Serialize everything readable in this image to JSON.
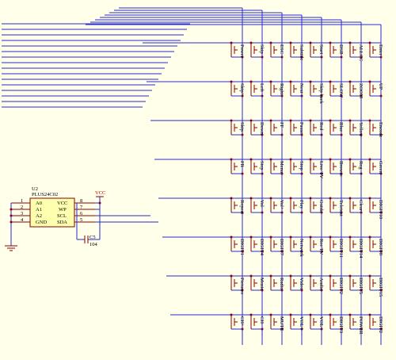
{
  "ic": {
    "ref": "U2",
    "part": "PLUS24C02",
    "left_pins": [
      {
        "name": "A0",
        "num": "1"
      },
      {
        "name": "A1",
        "num": "2"
      },
      {
        "name": "A2",
        "num": "3"
      },
      {
        "name": "GND",
        "num": "4"
      }
    ],
    "right_pins": [
      {
        "name": "VCC",
        "num": "8"
      },
      {
        "name": "WP",
        "num": "7"
      },
      {
        "name": "SCL",
        "num": "6"
      },
      {
        "name": "SDA",
        "num": "5"
      }
    ]
  },
  "vcc_label": "VCC",
  "cap": {
    "ref": "C5",
    "value": "104"
  },
  "keys": [
    [
      "Power",
      "Skip",
      "ESC",
      "Subtitle",
      "Start",
      "DSB",
      "ALLCC",
      "Enter"
    ],
    [
      "Skip+",
      "Left",
      "Right",
      "Next",
      "Skip back",
      "SLOW",
      "ZOOM",
      "UP"
    ],
    [
      "Skip-",
      "Down",
      "FF",
      "Pause",
      "Red",
      "Blue",
      "Yellow",
      "Encode"
    ],
    [
      "FR",
      "Step",
      "Menu",
      "Stop",
      "Live TV",
      "Browse",
      "Reg",
      "Green"
    ],
    [
      "Repeat",
      "Vol-",
      "Vol+",
      "Play",
      "Guide",
      "Teletext",
      "Clear",
      "DIGIT10"
    ],
    [
      "DIGIT1",
      "DIGIT4",
      "DIGIT7",
      "Network",
      "Rec TV",
      "DIGIT11",
      "DIGIT14",
      "DIGIT8"
    ],
    [
      "Pictures",
      "Music",
      "Radio",
      "Video",
      "Audio",
      "DIGIT2",
      "DIGIT5",
      "DIGIT15"
    ],
    [
      "CH+",
      "CH-",
      "MUTE",
      "VOL+",
      "VOL-",
      "DIGIT3",
      "POWER",
      "DIGIT2"
    ]
  ]
}
